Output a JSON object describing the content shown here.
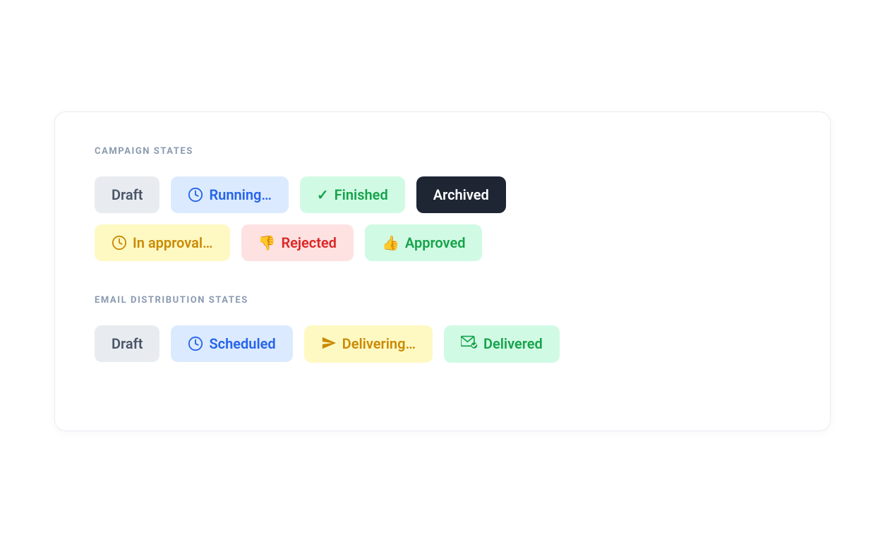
{
  "campaign_states": {
    "title": "CAMPAIGN STATES",
    "badges": [
      {
        "id": "draft",
        "label": "Draft",
        "icon": null,
        "style": "badge-draft"
      },
      {
        "id": "running",
        "label": "Running…",
        "icon": "clock",
        "style": "badge-running"
      },
      {
        "id": "finished",
        "label": "Finished",
        "icon": "check",
        "style": "badge-finished"
      },
      {
        "id": "archived",
        "label": "Archived",
        "icon": null,
        "style": "badge-archived"
      },
      {
        "id": "in-approval",
        "label": "In approval…",
        "icon": "clock",
        "style": "badge-in-approval"
      },
      {
        "id": "rejected",
        "label": "Rejected",
        "icon": "thumbs-down",
        "style": "badge-rejected"
      },
      {
        "id": "approved",
        "label": "Approved",
        "icon": "thumbs-up",
        "style": "badge-approved"
      }
    ]
  },
  "email_distribution_states": {
    "title": "EMAIL DISTRIBUTION STATES",
    "badges": [
      {
        "id": "draft2",
        "label": "Draft",
        "icon": null,
        "style": "badge-draft"
      },
      {
        "id": "scheduled",
        "label": "Scheduled",
        "icon": "clock",
        "style": "badge-scheduled"
      },
      {
        "id": "delivering",
        "label": "Delivering…",
        "icon": "paper-plane",
        "style": "badge-delivering"
      },
      {
        "id": "delivered",
        "label": "Delivered",
        "icon": "envelope-check",
        "style": "badge-delivered"
      }
    ]
  }
}
